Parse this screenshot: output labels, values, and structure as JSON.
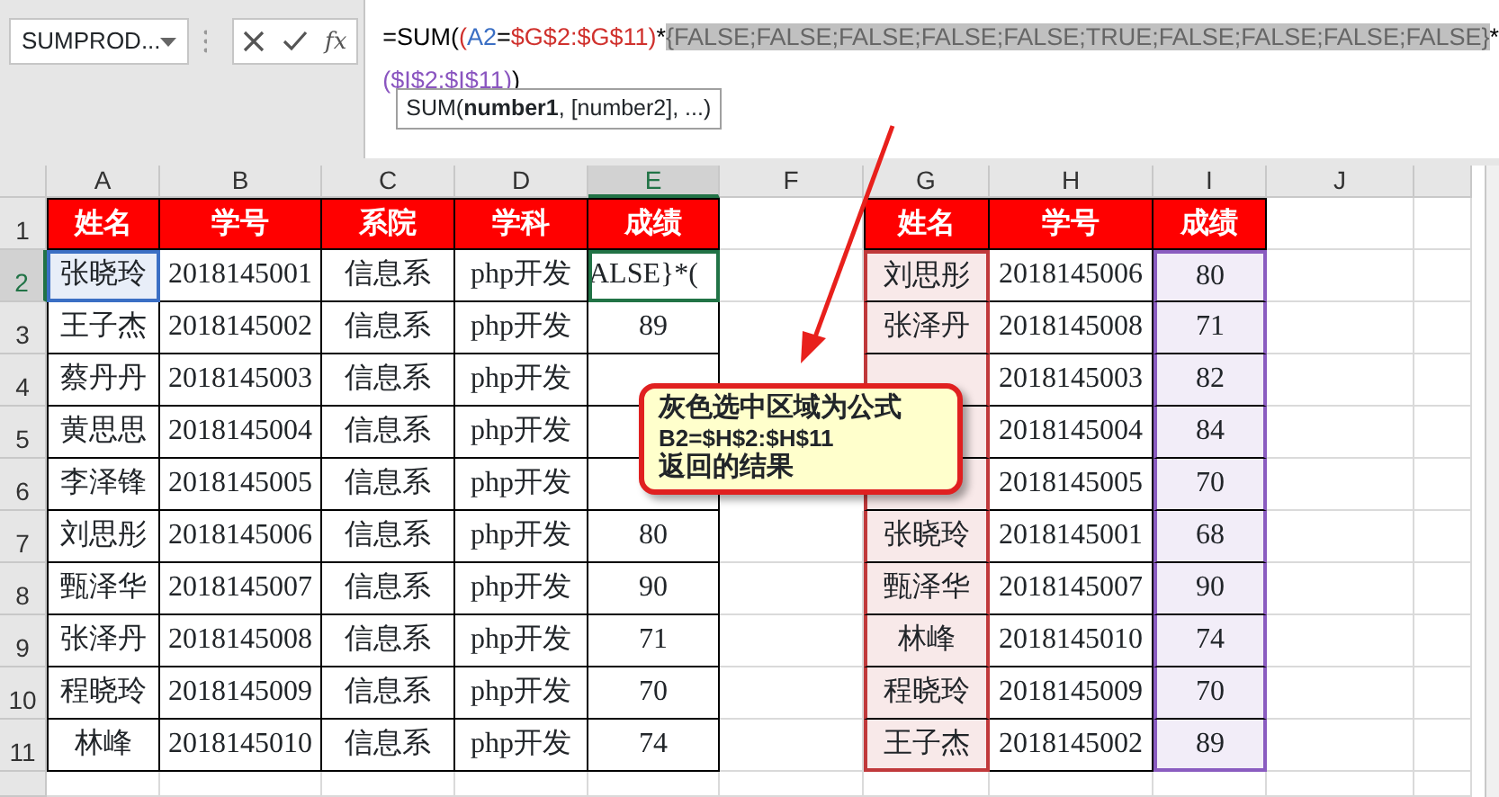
{
  "name_box": {
    "value": "SUMPROD..."
  },
  "formula_buttons": {
    "function_label": "fx"
  },
  "formula_bar": {
    "lines": [
      [
        {
          "text": "=SUM(",
          "color": "#000000",
          "selected": false
        },
        {
          "text": "(",
          "color": "#d0312d",
          "selected": false
        },
        {
          "text": "A2",
          "color": "#3b6fc4",
          "selected": false
        },
        {
          "text": "=",
          "color": "#000000",
          "selected": false
        },
        {
          "text": "$G$2:$G$11",
          "color": "#d0312d",
          "selected": false
        },
        {
          "text": ")",
          "color": "#d0312d",
          "selected": false
        },
        {
          "text": "*",
          "color": "#000000",
          "selected": false
        },
        {
          "text": "{FALSE;FALSE;FALSE;FALSE;FALSE;TRUE;FALSE;FALSE;FALSE;FALSE}",
          "color": "#666666",
          "selected": true
        },
        {
          "text": "*",
          "color": "#000000",
          "selected": false
        }
      ],
      [
        {
          "text": "(",
          "color": "#8a55c0",
          "selected": false
        },
        {
          "text": "$I$2:$I$11",
          "color": "#8a55c0",
          "selected": false
        },
        {
          "text": ")",
          "color": "#8a55c0",
          "selected": false
        },
        {
          "text": ")",
          "color": "#000000",
          "selected": false
        }
      ]
    ],
    "tooltip": "SUM(**number1**, [number2], ...)"
  },
  "columns": [
    {
      "label": "A",
      "selected": false
    },
    {
      "label": "B",
      "selected": false
    },
    {
      "label": "C",
      "selected": false
    },
    {
      "label": "D",
      "selected": false
    },
    {
      "label": "E",
      "selected": true
    },
    {
      "label": "F",
      "selected": false
    },
    {
      "label": "G",
      "selected": false
    },
    {
      "label": "H",
      "selected": false
    },
    {
      "label": "I",
      "selected": false
    },
    {
      "label": "J",
      "selected": false
    }
  ],
  "right_table_columns": [
    {
      "highlighted": true,
      "color": "#c0393b"
    },
    {
      "highlighted": false
    },
    {
      "highlighted": true,
      "color": "#8a5cc0"
    }
  ],
  "rows": [
    {
      "number": "1",
      "selected": false,
      "kind": "header",
      "name_referenced": false,
      "score_editing": false,
      "left": {
        "name": "姓名",
        "student_id": "学号",
        "department": "系院",
        "subject": "学科",
        "score": "成绩"
      },
      "right": {
        "name": "姓名",
        "student_id": "学号",
        "score": "成绩"
      }
    },
    {
      "number": "2",
      "selected": true,
      "kind": "data",
      "name_referenced": true,
      "score_editing": true,
      "left": {
        "name": "张晓玲",
        "student_id": "2018145001",
        "department": "信息系",
        "subject": "php开发",
        "score": "ALSE}*("
      },
      "right": {
        "name": "刘思彤",
        "student_id": "2018145006",
        "score": "80"
      }
    },
    {
      "number": "3",
      "selected": false,
      "kind": "data",
      "name_referenced": false,
      "score_editing": false,
      "left": {
        "name": "王子杰",
        "student_id": "2018145002",
        "department": "信息系",
        "subject": "php开发",
        "score": "89"
      },
      "right": {
        "name": "张泽丹",
        "student_id": "2018145008",
        "score": "71"
      }
    },
    {
      "number": "4",
      "selected": false,
      "kind": "data",
      "name_referenced": false,
      "score_editing": false,
      "left": {
        "name": "蔡丹丹",
        "student_id": "2018145003",
        "department": "信息系",
        "subject": "php开发"
      },
      "right": {
        "student_id": "2018145003",
        "score": "82"
      }
    },
    {
      "number": "5",
      "selected": false,
      "kind": "data",
      "name_referenced": false,
      "score_editing": false,
      "left": {
        "name": "黄思思",
        "student_id": "2018145004",
        "department": "信息系",
        "subject": "php开发"
      },
      "right": {
        "student_id": "2018145004",
        "score": "84"
      }
    },
    {
      "number": "6",
      "selected": false,
      "kind": "data",
      "name_referenced": false,
      "score_editing": false,
      "left": {
        "name": "李泽锋",
        "student_id": "2018145005",
        "department": "信息系",
        "subject": "php开发"
      },
      "right": {
        "student_id": "2018145005",
        "score": "70"
      }
    },
    {
      "number": "7",
      "selected": false,
      "kind": "data",
      "name_referenced": false,
      "score_editing": false,
      "left": {
        "name": "刘思彤",
        "student_id": "2018145006",
        "department": "信息系",
        "subject": "php开发",
        "score": "80"
      },
      "right": {
        "name": "张晓玲",
        "student_id": "2018145001",
        "score": "68"
      }
    },
    {
      "number": "8",
      "selected": false,
      "kind": "data",
      "name_referenced": false,
      "score_editing": false,
      "left": {
        "name": "甄泽华",
        "student_id": "2018145007",
        "department": "信息系",
        "subject": "php开发",
        "score": "90"
      },
      "right": {
        "name": "甄泽华",
        "student_id": "2018145007",
        "score": "90"
      }
    },
    {
      "number": "9",
      "selected": false,
      "kind": "data",
      "name_referenced": false,
      "score_editing": false,
      "left": {
        "name": "张泽丹",
        "student_id": "2018145008",
        "department": "信息系",
        "subject": "php开发",
        "score": "71"
      },
      "right": {
        "name": "林峰",
        "student_id": "2018145010",
        "score": "74"
      }
    },
    {
      "number": "10",
      "selected": false,
      "kind": "data",
      "name_referenced": false,
      "score_editing": false,
      "left": {
        "name": "程晓玲",
        "student_id": "2018145009",
        "department": "信息系",
        "subject": "php开发",
        "score": "70"
      },
      "right": {
        "name": "程晓玲",
        "student_id": "2018145009",
        "score": "70"
      }
    },
    {
      "number": "11",
      "selected": false,
      "kind": "data",
      "name_referenced": false,
      "score_editing": false,
      "left": {
        "name": "林峰",
        "student_id": "2018145010",
        "department": "信息系",
        "subject": "php开发",
        "score": "74"
      },
      "right": {
        "name": "王子杰",
        "student_id": "2018145002",
        "score": "89"
      }
    }
  ],
  "callout": {
    "lines": [
      "灰色选中区域为公式",
      "B2=$H$2:$H$11",
      "返回的结果"
    ]
  }
}
